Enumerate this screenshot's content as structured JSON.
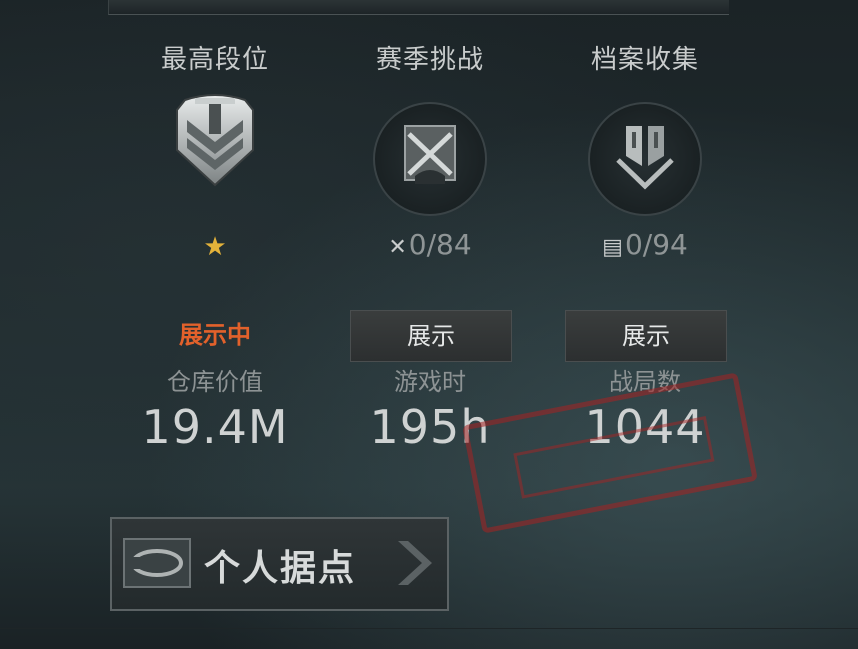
{
  "columns": {
    "rank": {
      "title": "最高段位",
      "status": "展示中",
      "star": "★"
    },
    "season": {
      "title": "赛季挑战",
      "progress": "0/84",
      "button": "展示",
      "icon": "crossed-swords-icon"
    },
    "archive": {
      "title": "档案收集",
      "progress": "0/94",
      "button": "展示",
      "icon": "document-icon"
    }
  },
  "stats": [
    {
      "label": "仓库价值",
      "value": "19.4M"
    },
    {
      "label": "游戏时",
      "value": "195h"
    },
    {
      "label": "战局数",
      "value": "1044"
    }
  ],
  "base_button": {
    "label": "个人据点"
  },
  "colors": {
    "accent_orange": "#e2612b",
    "star_gold": "#e3b23a",
    "stamp_red": "#a52323"
  }
}
